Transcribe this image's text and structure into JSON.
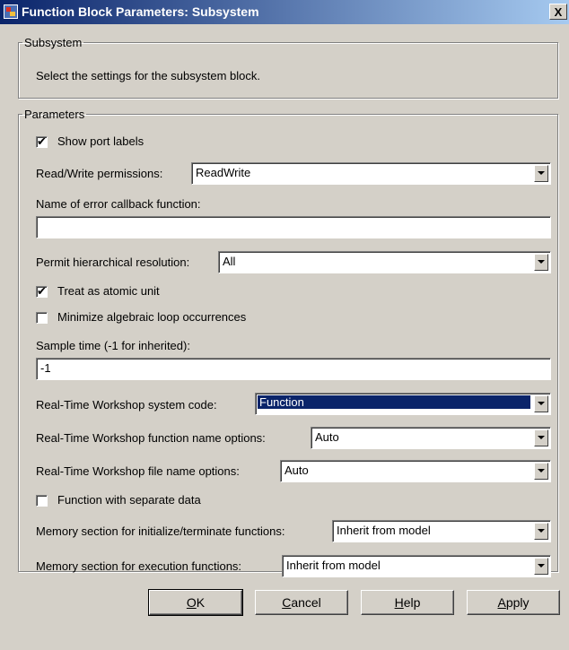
{
  "window": {
    "title": "Function Block Parameters: Subsystem",
    "close_glyph": "X"
  },
  "subsystem": {
    "group_label": "Subsystem",
    "description": "Select the settings for the subsystem block."
  },
  "parameters": {
    "group_label": "Parameters",
    "show_port_labels": {
      "label": "Show port labels",
      "checked": true
    },
    "read_write": {
      "label": "Read/Write permissions:",
      "value": "ReadWrite"
    },
    "error_callback": {
      "label": "Name of error callback function:",
      "value": ""
    },
    "hierarchical": {
      "label": "Permit hierarchical resolution:",
      "value": "All"
    },
    "atomic": {
      "label": "Treat as atomic unit",
      "checked": true
    },
    "min_loop": {
      "label": "Minimize algebraic loop occurrences",
      "checked": false
    },
    "sample_time": {
      "label": "Sample time (-1 for inherited):",
      "value": "-1"
    },
    "rtw_code": {
      "label": "Real-Time Workshop system code:",
      "value": "Function"
    },
    "rtw_func_name": {
      "label": "Real-Time Workshop function name options:",
      "value": "Auto"
    },
    "rtw_file_name": {
      "label": "Real-Time Workshop file name options:",
      "value": "Auto"
    },
    "sep_data": {
      "label": "Function with separate data",
      "checked": false
    },
    "mem_init": {
      "label": "Memory section for initialize/terminate functions:",
      "value": "Inherit from model"
    },
    "mem_exec": {
      "label": "Memory section for execution functions:",
      "value": "Inherit from model"
    }
  },
  "buttons": {
    "ok": {
      "key": "O",
      "rest": "K"
    },
    "cancel": {
      "key": "C",
      "rest": "ancel"
    },
    "help": {
      "key": "H",
      "rest": "elp"
    },
    "apply": {
      "key": "A",
      "rest": "pply"
    }
  },
  "check_glyph": "✔"
}
